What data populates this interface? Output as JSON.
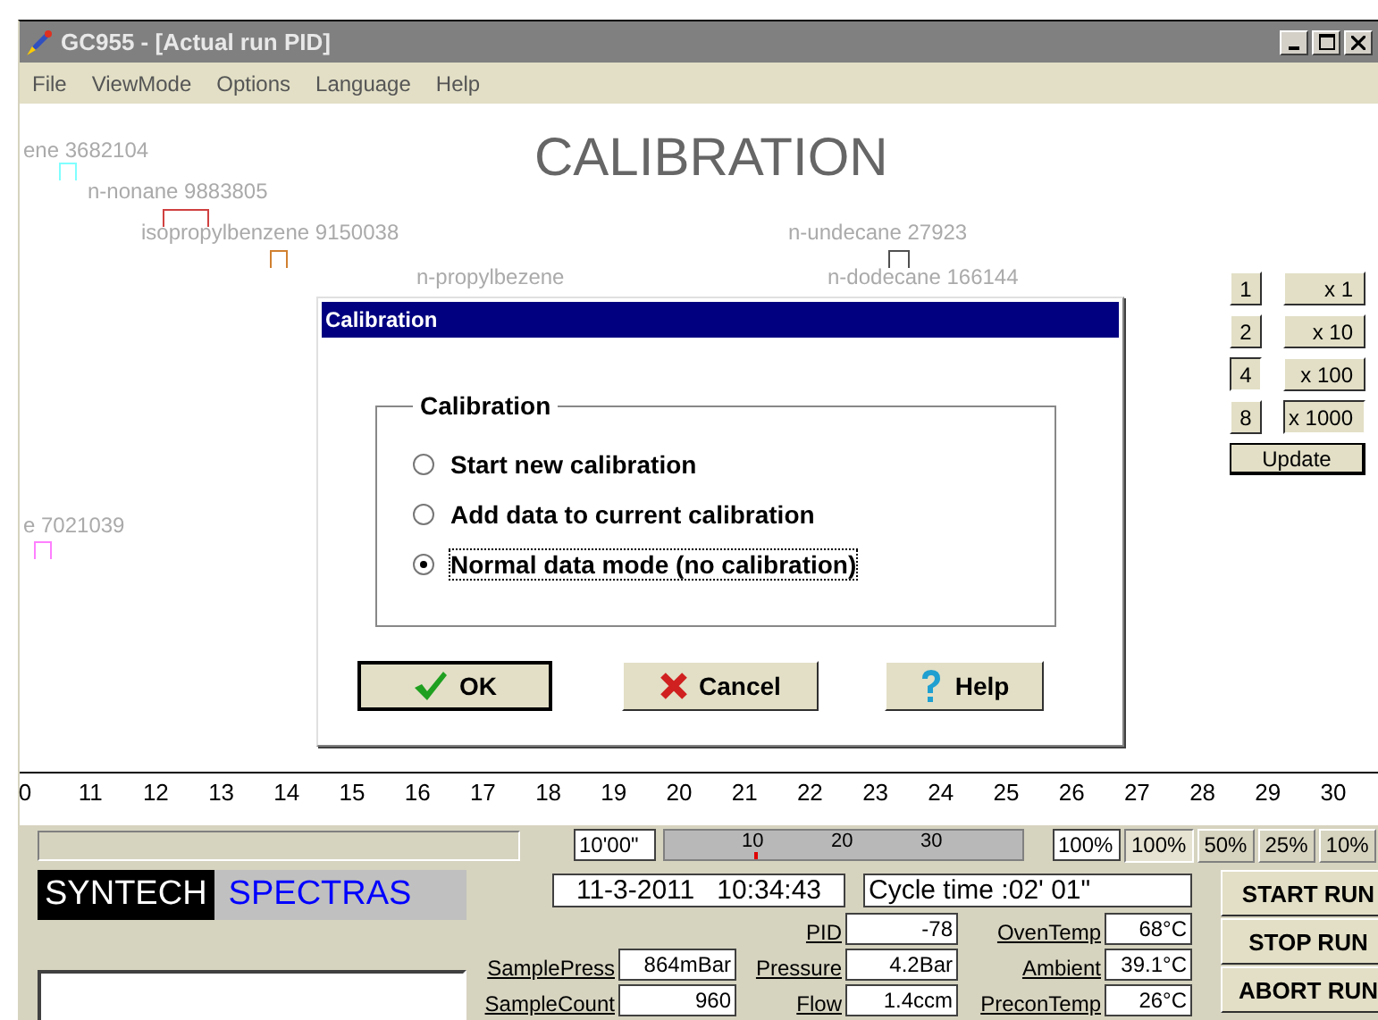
{
  "window": {
    "title": "GC955 - [Actual run PID]"
  },
  "menu": [
    "File",
    "ViewMode",
    "Options",
    "Language",
    "Help"
  ],
  "canvas": {
    "heading": "CALIBRATION",
    "peaks": [
      {
        "label": "ene 3682104",
        "color": "#80ffff"
      },
      {
        "label": "n-nonane 9883805",
        "color": "#d04040"
      },
      {
        "label": "isopropylbenzene 9150038",
        "color": "#d08030"
      },
      {
        "label": "n-propylbezene"
      },
      {
        "label": "n-undecane 27923",
        "color": "#505050"
      },
      {
        "label": "n-dodecane 166144"
      },
      {
        "label": "e 7021039",
        "color": "#ff80ff"
      }
    ],
    "axis_labels": [
      "0",
      "11",
      "12",
      "13",
      "14",
      "15",
      "16",
      "17",
      "18",
      "19",
      "20",
      "21",
      "22",
      "23",
      "24",
      "25",
      "26",
      "27",
      "28",
      "29",
      "30"
    ]
  },
  "scale": {
    "factors": [
      {
        "label": "1",
        "selected": false
      },
      {
        "label": "2",
        "selected": false
      },
      {
        "label": "4",
        "selected": true
      },
      {
        "label": "8",
        "selected": false
      }
    ],
    "multipliers": [
      {
        "label": "x 1",
        "selected": false
      },
      {
        "label": "x 10",
        "selected": false
      },
      {
        "label": "x 100",
        "selected": false
      },
      {
        "label": "x 1000",
        "selected": true
      }
    ],
    "update": "Update"
  },
  "dialog": {
    "title": "Calibration",
    "group_label": "Calibration",
    "options": [
      {
        "label": "Start new calibration",
        "selected": false
      },
      {
        "label": "Add data to current calibration",
        "selected": false
      },
      {
        "label": "Normal data mode (no calibration)",
        "selected": true
      }
    ],
    "buttons": [
      {
        "label": "OK",
        "kind": "ok"
      },
      {
        "label": "Cancel",
        "kind": "cancel"
      },
      {
        "label": "Help",
        "kind": "help"
      }
    ]
  },
  "run_bar": {
    "duration": "10'00\"",
    "slider": {
      "ticks": [
        "10",
        "20",
        "30"
      ],
      "level": 0.25
    },
    "zoom_value": "100%",
    "zoom_buttons": [
      {
        "label": "100%",
        "selected": true
      },
      {
        "label": "50%",
        "selected": false
      },
      {
        "label": "25%",
        "selected": false
      },
      {
        "label": "10%",
        "selected": false
      }
    ]
  },
  "brand": {
    "left": "SYNTECH",
    "right": "SPECTRAS"
  },
  "datetime": "11-3-2011   10:34:43",
  "cycle_time": "Cycle time :02' 01\"",
  "readings": [
    {
      "label": "PID",
      "value": "-78"
    },
    {
      "label": "OvenTemp",
      "value": "68°C"
    },
    {
      "label": "SamplePress",
      "value": "864mBar"
    },
    {
      "label": "Pressure",
      "value": "4.2Bar"
    },
    {
      "label": "Ambient",
      "value": "39.1°C"
    },
    {
      "label": "SampleCount",
      "value": "960"
    },
    {
      "label": "Flow",
      "value": "1.4ccm"
    },
    {
      "label": "PreconTemp",
      "value": "26°C"
    }
  ],
  "run_buttons": [
    "START RUN",
    "STOP RUN",
    "ABORT RUN"
  ]
}
